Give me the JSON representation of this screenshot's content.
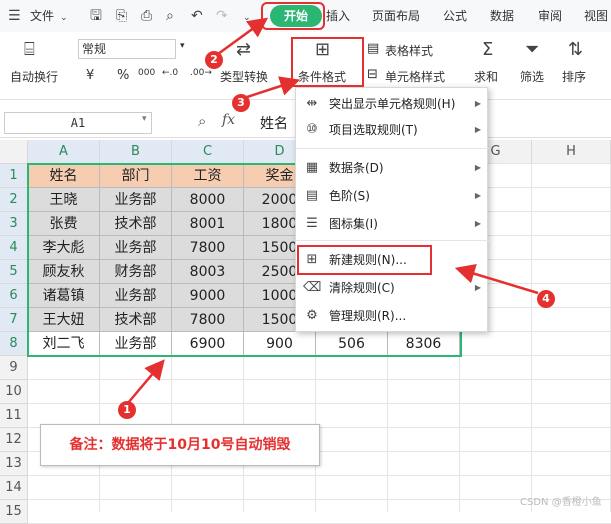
{
  "tabbar": {
    "file_label": "文件",
    "tabs": [
      "开始",
      "插入",
      "页面布局",
      "公式",
      "数据",
      "审阅",
      "视图"
    ]
  },
  "ribbon": {
    "wrap_label": "自动换行",
    "number_format": "常规",
    "currency_symbol": "¥",
    "percent_symbol": "%",
    "thousands_symbol": "000",
    "inc_decimal": "←.0",
    "dec_decimal": ".00→",
    "type_convert_label": "类型转换",
    "conditional_format_label": "条件格式",
    "table_style_label": "表格样式",
    "cell_style_label": "单元格样式",
    "sum_label": "求和",
    "filter_label": "筛选",
    "sort_label": "排序"
  },
  "formula_bar": {
    "name_box": "A1",
    "fx": "fx",
    "content": "姓名"
  },
  "sheet": {
    "columns": [
      "A",
      "B",
      "C",
      "D",
      "E",
      "F",
      "G",
      "H"
    ],
    "rows": [
      "1",
      "2",
      "3",
      "4",
      "5",
      "6",
      "7",
      "8",
      "9",
      "10",
      "11",
      "12",
      "13",
      "14",
      "15"
    ],
    "table": [
      [
        "姓名",
        "部门",
        "工资",
        "奖金",
        "",
        ""
      ],
      [
        "王晓",
        "业务部",
        "8000",
        "2000",
        "",
        ""
      ],
      [
        "张费",
        "技术部",
        "8001",
        "1800",
        "",
        ""
      ],
      [
        "李大彪",
        "业务部",
        "7800",
        "1500",
        "",
        ""
      ],
      [
        "顾友秋",
        "财务部",
        "8003",
        "2500",
        "",
        ""
      ],
      [
        "诸葛镇",
        "业务部",
        "9000",
        "1000",
        "",
        ""
      ],
      [
        "王大妞",
        "技术部",
        "7800",
        "1500",
        "",
        ""
      ],
      [
        "刘二飞",
        "业务部",
        "6900",
        "900",
        "506",
        "8306"
      ]
    ]
  },
  "menu": {
    "items": [
      {
        "label": "突出显示单元格规则(H)",
        "icon": "highlight-rules-icon",
        "glyph": "⇹",
        "submenu": true
      },
      {
        "label": "项目选取规则(T)",
        "icon": "top-bottom-rules-icon",
        "glyph": "⑩",
        "submenu": true
      },
      {
        "label": "数据条(D)",
        "icon": "data-bars-icon",
        "glyph": "▦",
        "submenu": true
      },
      {
        "label": "色阶(S)",
        "icon": "color-scale-icon",
        "glyph": "▤",
        "submenu": true
      },
      {
        "label": "图标集(I)",
        "icon": "icon-sets-icon",
        "glyph": "☰",
        "submenu": true
      },
      {
        "label": "新建规则(N)...",
        "icon": "new-rule-icon",
        "glyph": "⊞",
        "submenu": false
      },
      {
        "label": "清除规则(C)",
        "icon": "clear-rules-icon",
        "glyph": "⌫",
        "submenu": true
      },
      {
        "label": "管理规则(R)...",
        "icon": "manage-rules-icon",
        "glyph": "⚙",
        "submenu": false
      }
    ]
  },
  "annotations": {
    "badges": [
      "1",
      "2",
      "3",
      "4"
    ],
    "note": "备注：数据将于10月10号自动销毁"
  },
  "colors": {
    "accent_green": "#2bb673",
    "annotation_red": "#e53030",
    "header_fill": "#f6cdb0",
    "data_fill": "#dcdcdc"
  },
  "watermark": "CSDN @香橙小鱼"
}
